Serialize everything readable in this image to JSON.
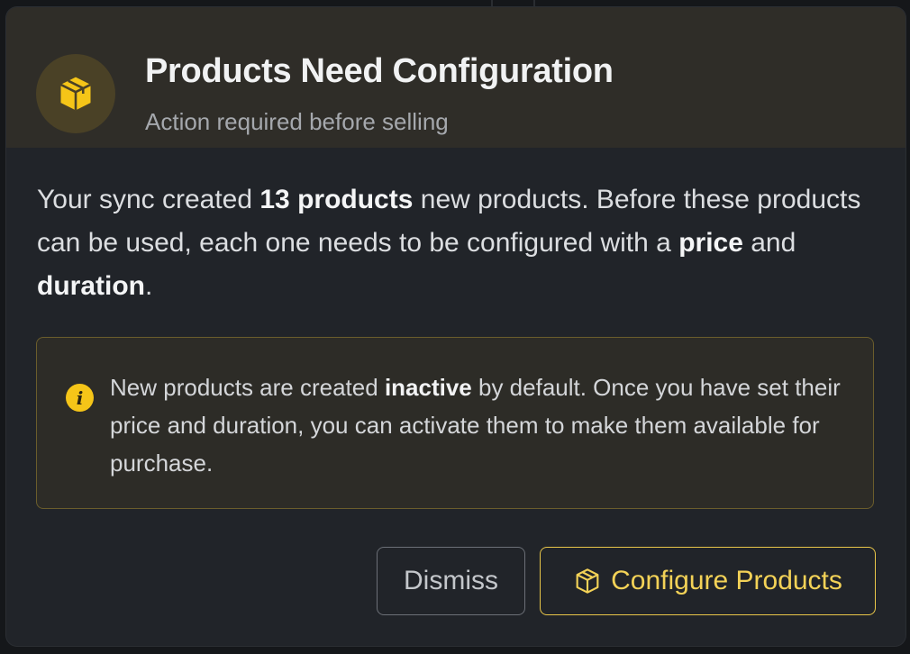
{
  "colors": {
    "accent": "#f5c518",
    "modal_bg": "#212429",
    "header_bg": "#2f2d28",
    "notice_border": "#6b5d2c"
  },
  "header": {
    "icon": "package-icon",
    "title": "Products Need Configuration",
    "subtitle": "Action required before selling"
  },
  "message": {
    "part1": "Your sync created ",
    "count_strong": "13 products",
    "part2": " new products. Before these products can be used, each one needs to be configured with a ",
    "price_strong": "price",
    "part3": " and ",
    "duration_strong": "duration",
    "part4": "."
  },
  "notice": {
    "icon": "info-icon",
    "icon_glyph": "i",
    "part1": "New products are created ",
    "inactive_strong": "inactive",
    "part2": " by default. Once you have set their price and duration, you can activate them to make them available for purchase."
  },
  "actions": {
    "dismiss_label": "Dismiss",
    "configure_label": "Configure Products",
    "configure_icon": "package-outline-icon"
  }
}
